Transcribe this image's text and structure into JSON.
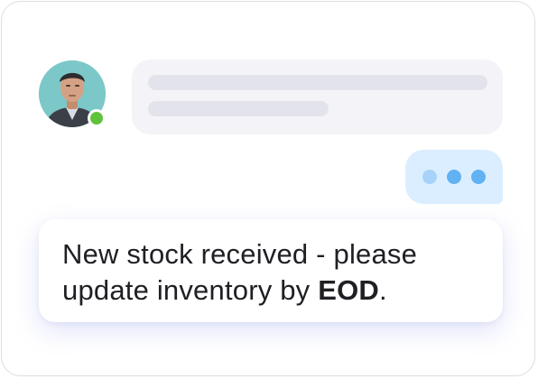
{
  "contact": {
    "avatar_icon": "user-avatar-photo",
    "status": "online",
    "status_color": "#5ec23a"
  },
  "incoming_message": {
    "state": "loading-placeholder"
  },
  "typing_indicator": {
    "icon": "typing-dots-icon",
    "bubble_color": "#dbeeff"
  },
  "message": {
    "text_before": "New stock received - please update inventory by ",
    "emphasis": "EOD",
    "text_after": "."
  }
}
